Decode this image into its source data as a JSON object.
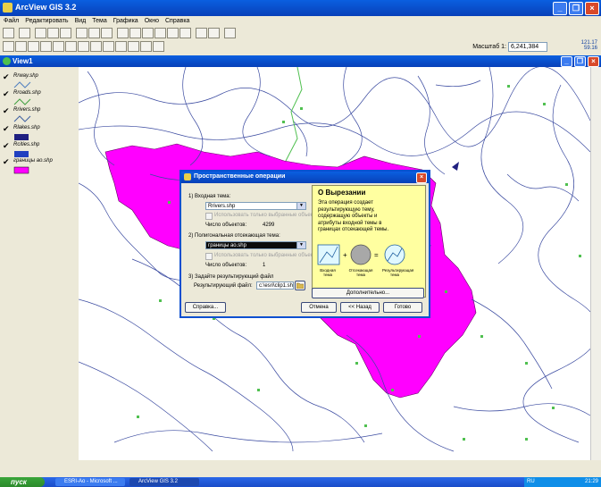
{
  "app": {
    "title": "ArcView GIS 3.2"
  },
  "menu": [
    "Файл",
    "Редактировать",
    "Вид",
    "Тема",
    "Графика",
    "Окно",
    "Справка"
  ],
  "scale": {
    "label": "Масштаб 1:",
    "value": "6,241,384"
  },
  "coords": {
    "x": "121.17",
    "y": "59.16"
  },
  "view": {
    "title": "View1"
  },
  "legend": [
    {
      "name": "Rrway.shp",
      "symbol": "line",
      "color": "#5080c0"
    },
    {
      "name": "Rroads.shp",
      "symbol": "line",
      "color": "#40a040"
    },
    {
      "name": "Rrivers.shp",
      "symbol": "line",
      "color": "#4060a0"
    },
    {
      "name": "Rlakes.shp",
      "symbol": "fill",
      "color": "#202080"
    },
    {
      "name": "Rcities.shp",
      "symbol": "fill",
      "color": "#2040c0"
    },
    {
      "name": "границы ao.shp",
      "symbol": "fill",
      "color": "#ff00ff"
    }
  ],
  "dialog": {
    "title": "Пространственные операции",
    "step1": "1) Входная тема:",
    "input_theme": "Rrivers.shp",
    "use_selected": "Использовать только выбранные объекты",
    "count_label": "Число объектов:",
    "count1": "4299",
    "step2": "2) Полигональная отсекающая тема:",
    "clip_theme": "границы ao.shp",
    "count2": "1",
    "step3": "3) Задайте результирующий файл",
    "result_label": "Результирующий файл:",
    "result_value": "c:\\esri\\clip1.shp",
    "btn_help": "Справка...",
    "btn_cancel": "Отмена",
    "btn_back": "<< Назад",
    "btn_done": "Готово",
    "btn_more": "Дополнительно...",
    "help_title": "О Вырезании",
    "help_text": "Эта операция создает результирующую тему, содержащую объекты и атрибуты входной темы в границах отсекающей темы.",
    "cap_input": "Входная тема",
    "cap_clip": "Отсекающая тема",
    "cap_result": "Результирующая тема"
  },
  "taskbar": {
    "start": "пуск",
    "tasks": [
      "ESRI-Ao - Microsoft ...",
      "ArcView GIS 3.2"
    ],
    "lang": "RU",
    "time": "21:29"
  },
  "colors": {
    "clip_region": "#ff00ff",
    "rivers": "#3a4aa0",
    "roads": "#50c050"
  }
}
